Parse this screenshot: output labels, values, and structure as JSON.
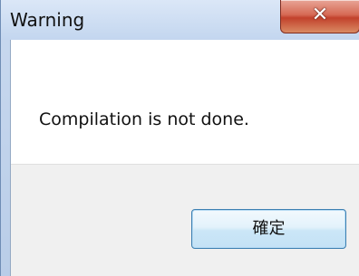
{
  "dialog": {
    "title": "Warning",
    "message": "Compilation is not done.",
    "ok_label": "確定"
  }
}
